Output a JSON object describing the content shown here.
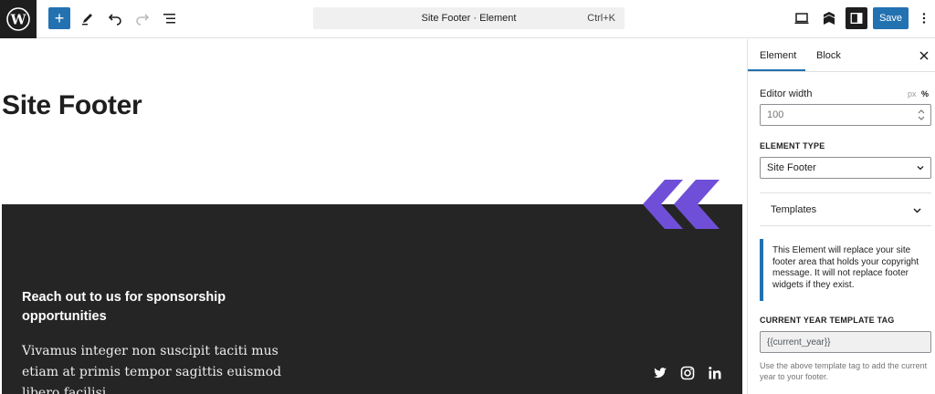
{
  "toolbar": {
    "add_label": "+",
    "document_title": "Site Footer · Element",
    "shortcut": "Ctrl+K",
    "save_label": "Save"
  },
  "canvas": {
    "page_title": "Site Footer",
    "footer": {
      "heading": "Reach out to us for sponsorship opportunities",
      "body": "Vivamus integer non suscipit taciti mus etiam at primis tempor sagittis euismod libero facilisi.",
      "accent_color": "#6f4fd8",
      "background_color": "#252525",
      "social_icons": [
        "twitter-icon",
        "instagram-icon",
        "linkedin-icon"
      ]
    }
  },
  "sidebar": {
    "tabs": [
      {
        "label": "Element",
        "active": true
      },
      {
        "label": "Block",
        "active": false
      }
    ],
    "editor_width": {
      "label": "Editor width",
      "units": [
        "px",
        "%"
      ],
      "active_unit": "%",
      "placeholder": "100"
    },
    "element_type": {
      "label": "ELEMENT TYPE",
      "selected": "Site Footer"
    },
    "templates_panel": {
      "title": "Templates"
    },
    "notice": "This Element will replace your site footer area that holds your copyright message. It will not replace footer widgets if they exist.",
    "year_tag": {
      "label": "CURRENT YEAR TEMPLATE TAG",
      "value": "{{current_year}}",
      "help": "Use the above template tag to add the current year to your footer."
    }
  },
  "colors": {
    "primary": "#2271b1",
    "dark": "#1e1e1e"
  }
}
